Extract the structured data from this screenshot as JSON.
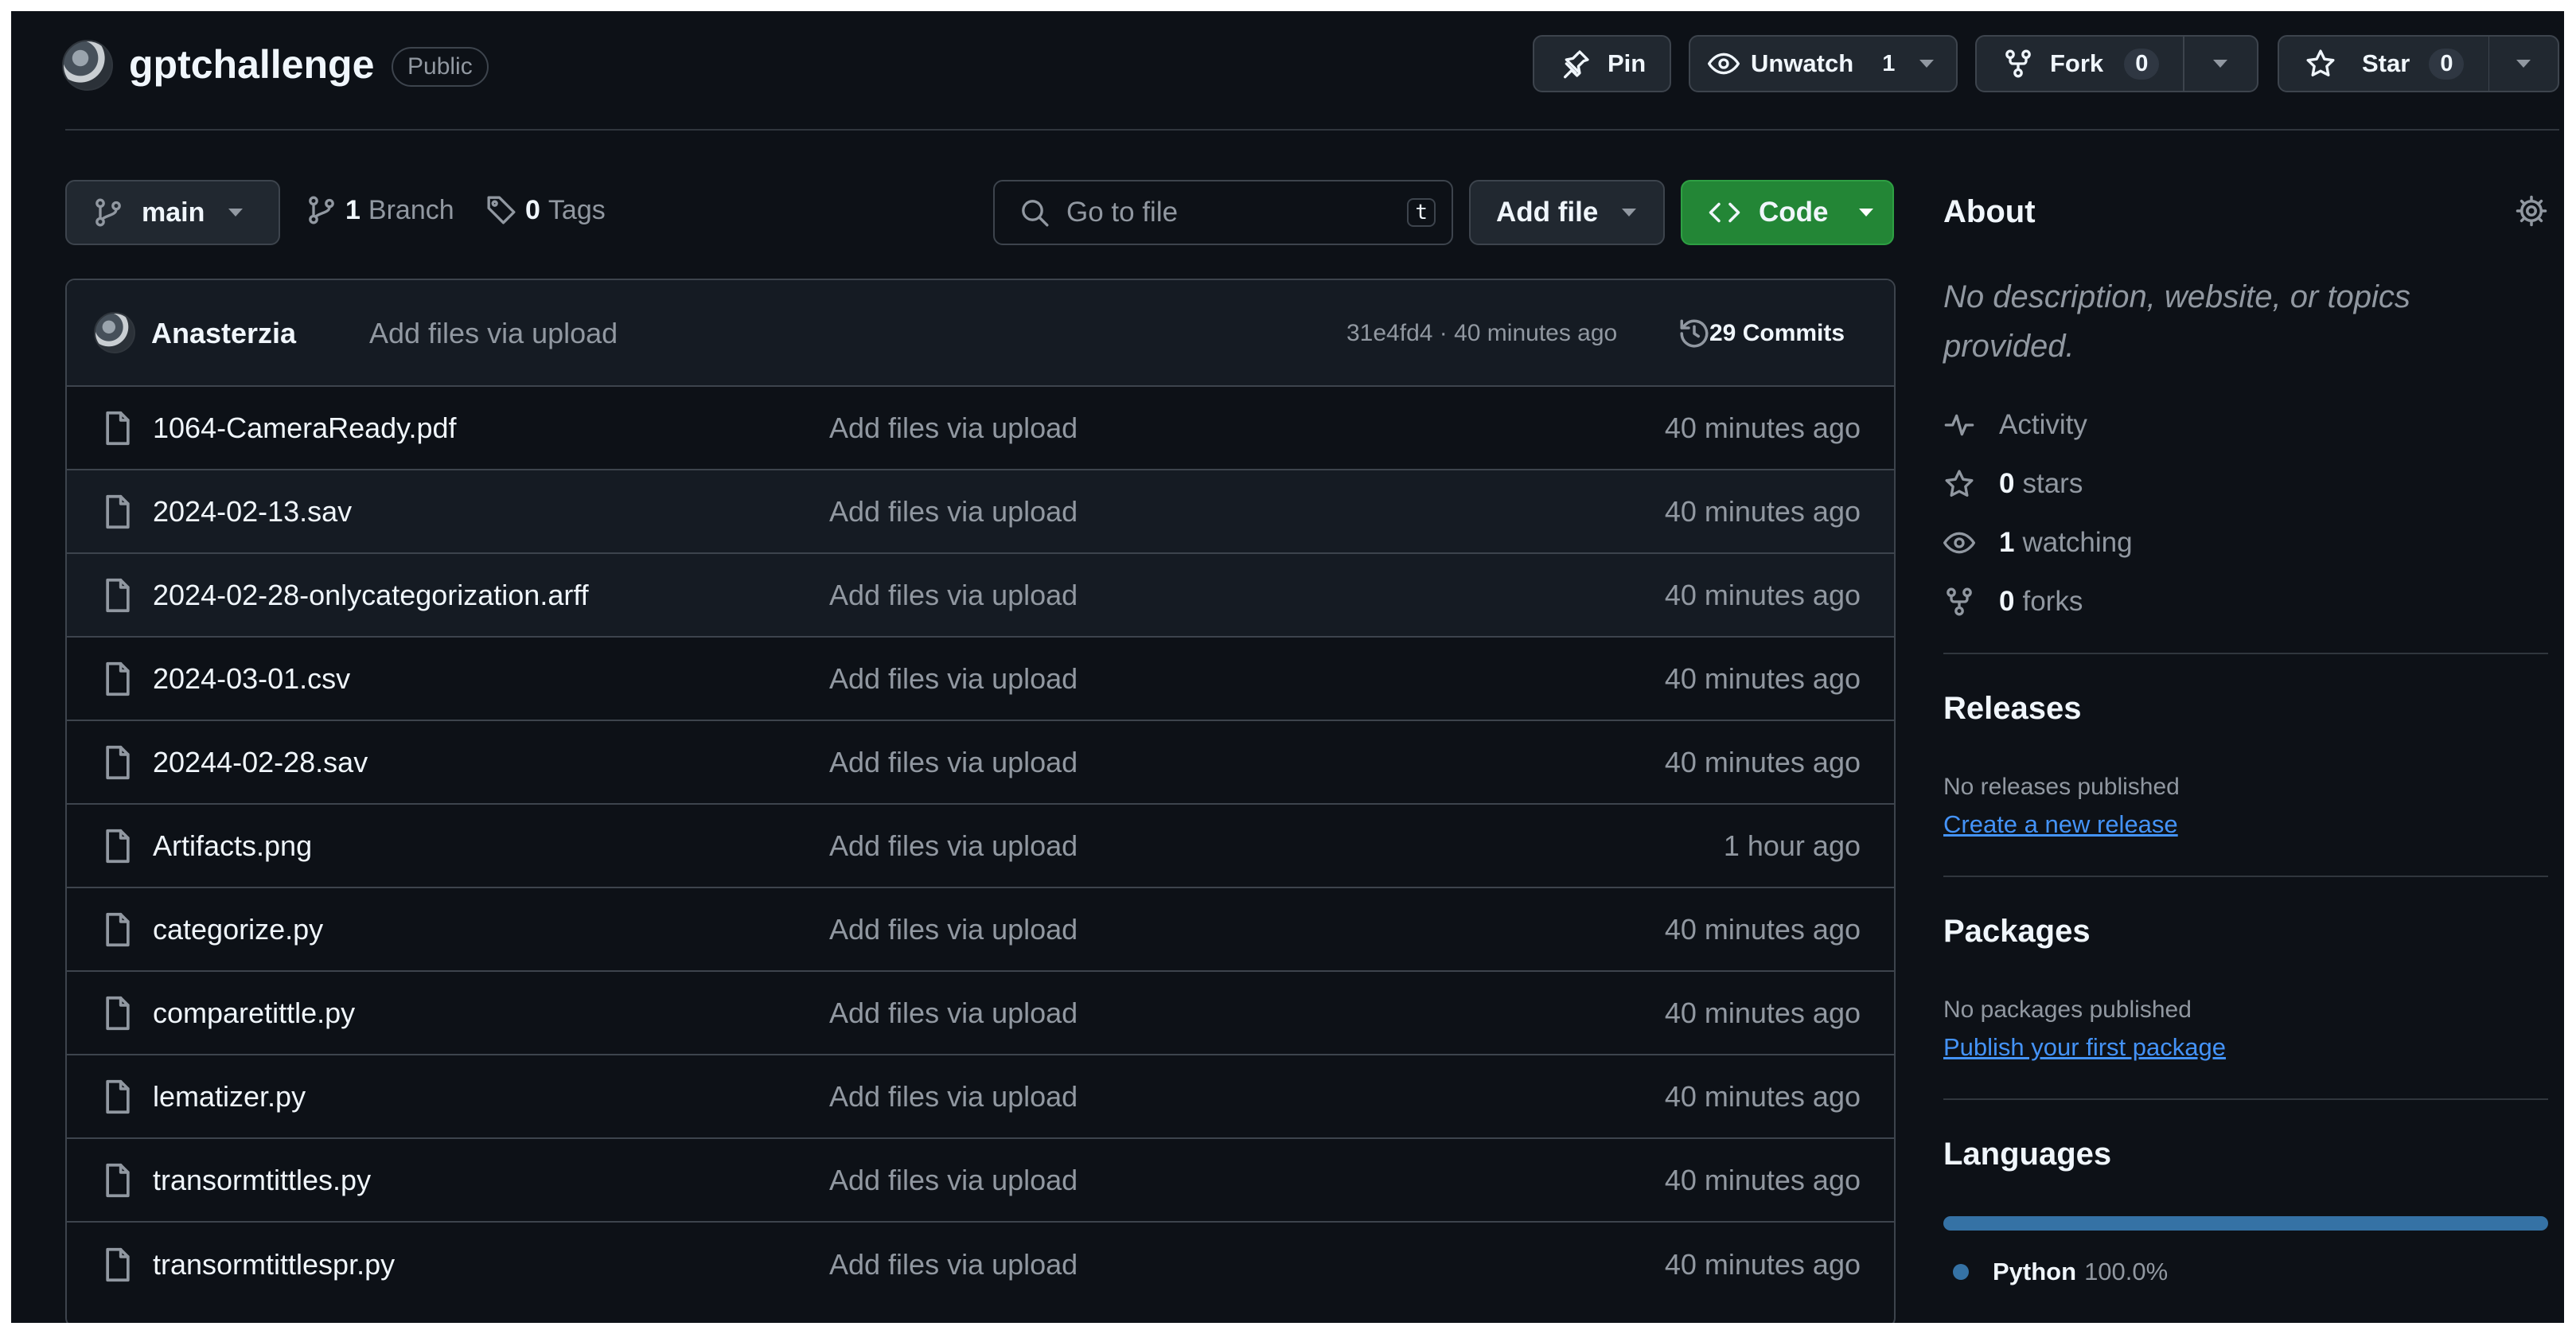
{
  "repo": {
    "name": "gptchallenge",
    "visibility": "Public"
  },
  "actions": {
    "pin": "Pin",
    "unwatch": "Unwatch",
    "watch_count": "1",
    "fork": "Fork",
    "fork_count": "0",
    "star": "Star",
    "star_count": "0"
  },
  "toolbar": {
    "branch": "main",
    "branch_count": "1",
    "branch_label": "Branch",
    "tag_count": "0",
    "tag_label": "Tags",
    "search_placeholder": "Go to file",
    "search_shortcut": "t",
    "add_file": "Add file",
    "code": "Code"
  },
  "commit": {
    "author": "Anasterzia",
    "message": "Add files via upload",
    "hash_time": "31e4fd4 · 40 minutes ago",
    "commits_label": "29 Commits"
  },
  "files": [
    {
      "name": "1064-CameraReady.pdf",
      "message": "Add files via upload",
      "age": "40 minutes ago"
    },
    {
      "name": "2024-02-13.sav",
      "message": "Add files via upload",
      "age": "40 minutes ago"
    },
    {
      "name": "2024-02-28-onlycategorization.arff",
      "message": "Add files via upload",
      "age": "40 minutes ago"
    },
    {
      "name": "2024-03-01.csv",
      "message": "Add files via upload",
      "age": "40 minutes ago"
    },
    {
      "name": "20244-02-28.sav",
      "message": "Add files via upload",
      "age": "40 minutes ago"
    },
    {
      "name": "Artifacts.png",
      "message": "Add files via upload",
      "age": "1 hour ago"
    },
    {
      "name": "categorize.py",
      "message": "Add files via upload",
      "age": "40 minutes ago"
    },
    {
      "name": "comparetittle.py",
      "message": "Add files via upload",
      "age": "40 minutes ago"
    },
    {
      "name": "lematizer.py",
      "message": "Add files via upload",
      "age": "40 minutes ago"
    },
    {
      "name": "transormtittles.py",
      "message": "Add files via upload",
      "age": "40 minutes ago"
    },
    {
      "name": "transormtittlespr.py",
      "message": "Add files via upload",
      "age": "40 minutes ago"
    }
  ],
  "about": {
    "title": "About",
    "description": "No description, website, or topics provided.",
    "activity": "Activity",
    "stars_count": "0",
    "stars_label": "stars",
    "watching_count": "1",
    "watching_label": "watching",
    "forks_count": "0",
    "forks_label": "forks"
  },
  "releases": {
    "title": "Releases",
    "text": "No releases published",
    "link": "Create a new release"
  },
  "packages": {
    "title": "Packages",
    "text": "No packages published",
    "link": "Publish your first package"
  },
  "languages": {
    "title": "Languages",
    "items": [
      {
        "name": "Python",
        "percent": "100.0%",
        "share": 1.0,
        "color": "#3572A5"
      }
    ]
  },
  "colors": {
    "background": "#0d1117",
    "border": "#3d444d",
    "accent_green": "#238636",
    "link_blue": "#4493f8",
    "python_blue": "#3572A5"
  }
}
